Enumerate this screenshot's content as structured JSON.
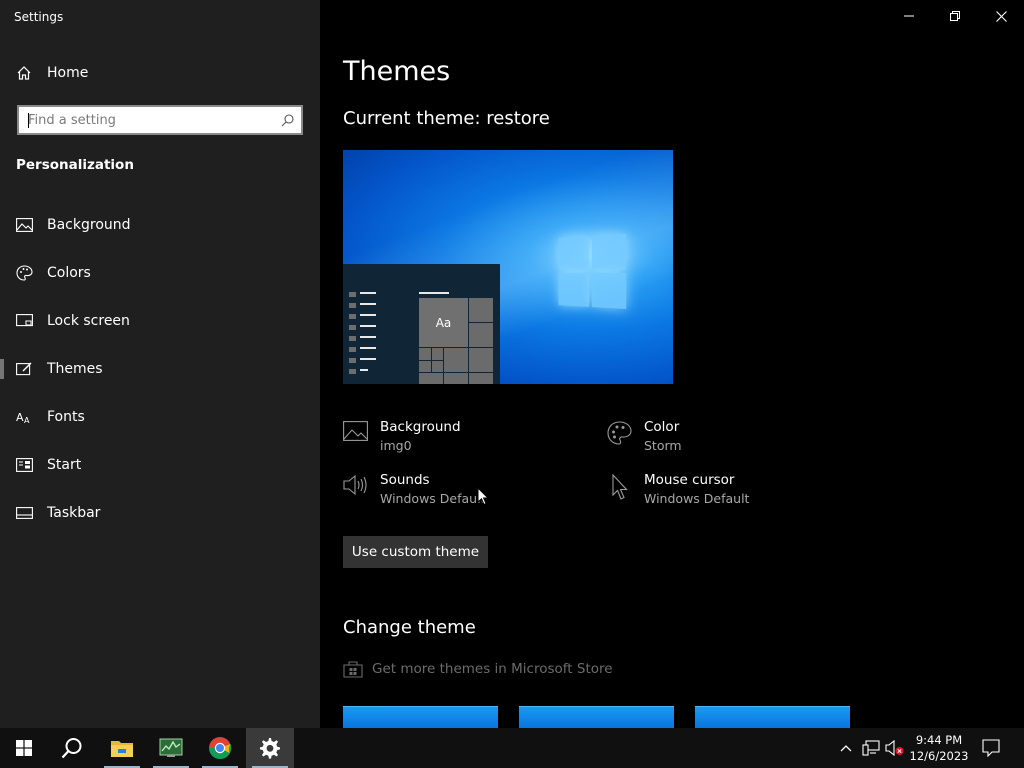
{
  "window": {
    "title": "Settings"
  },
  "sidebar": {
    "home_label": "Home",
    "search_placeholder": "Find a setting",
    "section_label": "Personalization",
    "items": [
      {
        "label": "Background",
        "icon": "picture-icon"
      },
      {
        "label": "Colors",
        "icon": "palette-icon"
      },
      {
        "label": "Lock screen",
        "icon": "lock-screen-icon"
      },
      {
        "label": "Themes",
        "icon": "themes-brush-icon",
        "selected": true
      },
      {
        "label": "Fonts",
        "icon": "fonts-icon"
      },
      {
        "label": "Start",
        "icon": "start-icon"
      },
      {
        "label": "Taskbar",
        "icon": "taskbar-icon"
      }
    ]
  },
  "main": {
    "title": "Themes",
    "current_theme": "Current theme: restore",
    "preview": {
      "tile_text": "Aa"
    },
    "properties": {
      "background": {
        "title": "Background",
        "value": "img0"
      },
      "color": {
        "title": "Color",
        "value": "Storm"
      },
      "sounds": {
        "title": "Sounds",
        "value": "Windows Default"
      },
      "mouse_cursor": {
        "title": "Mouse cursor",
        "value": "Windows Default"
      }
    },
    "custom_button": "Use custom theme",
    "change_theme_heading": "Change theme",
    "store_link": "Get more themes in Microsoft Store"
  },
  "taskbar": {
    "apps": [
      "windows-start-icon",
      "search-icon",
      "file-explorer-icon",
      "task-manager-icon",
      "chrome-icon",
      "settings-gear-icon"
    ],
    "time": "9:44 PM",
    "date": "12/6/2023"
  },
  "colors": {
    "sidebar_bg": "#1f1f1f",
    "main_bg": "#000000",
    "taskbar_bg": "#101010",
    "accent_blue": "#0a74de"
  }
}
